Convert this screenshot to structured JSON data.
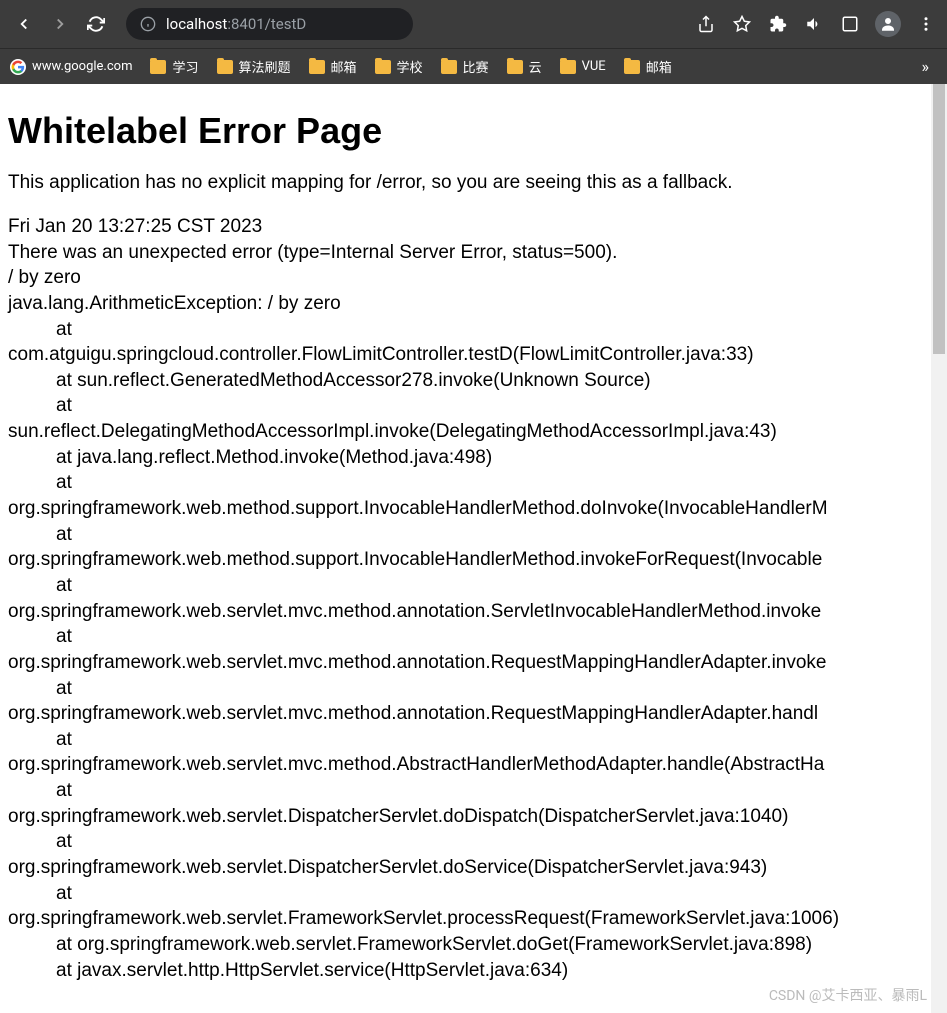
{
  "browser": {
    "url_host": "localhost",
    "url_port_path": ":8401/testD"
  },
  "bookmarks": [
    {
      "label": "www.google.com",
      "type": "google"
    },
    {
      "label": "学习",
      "type": "folder"
    },
    {
      "label": "算法刷题",
      "type": "folder"
    },
    {
      "label": "邮箱",
      "type": "folder"
    },
    {
      "label": "学校",
      "type": "folder"
    },
    {
      "label": "比赛",
      "type": "folder"
    },
    {
      "label": "云",
      "type": "folder"
    },
    {
      "label": "VUE",
      "type": "folder"
    },
    {
      "label": "邮箱",
      "type": "folder"
    }
  ],
  "more_bookmarks": "»",
  "page": {
    "title": "Whitelabel Error Page",
    "description": "This application has no explicit mapping for /error, so you are seeing this as a fallback.",
    "timestamp": "Fri Jan 20 13:27:25 CST 2023",
    "error_line": "There was an unexpected error (type=Internal Server Error, status=500).",
    "error_message": "/ by zero",
    "exception": "java.lang.ArithmeticException: / by zero",
    "stack_trace": [
      {
        "indent": true,
        "text": "at"
      },
      {
        "indent": false,
        "text": "com.atguigu.springcloud.controller.FlowLimitController.testD(FlowLimitController.java:33)"
      },
      {
        "indent": true,
        "text": "at sun.reflect.GeneratedMethodAccessor278.invoke(Unknown Source)"
      },
      {
        "indent": true,
        "text": "at"
      },
      {
        "indent": false,
        "text": "sun.reflect.DelegatingMethodAccessorImpl.invoke(DelegatingMethodAccessorImpl.java:43)"
      },
      {
        "indent": true,
        "text": "at java.lang.reflect.Method.invoke(Method.java:498)"
      },
      {
        "indent": true,
        "text": "at"
      },
      {
        "indent": false,
        "text": "org.springframework.web.method.support.InvocableHandlerMethod.doInvoke(InvocableHandlerM"
      },
      {
        "indent": true,
        "text": "at"
      },
      {
        "indent": false,
        "text": "org.springframework.web.method.support.InvocableHandlerMethod.invokeForRequest(Invocable"
      },
      {
        "indent": true,
        "text": "at"
      },
      {
        "indent": false,
        "text": "org.springframework.web.servlet.mvc.method.annotation.ServletInvocableHandlerMethod.invoke"
      },
      {
        "indent": true,
        "text": "at"
      },
      {
        "indent": false,
        "text": "org.springframework.web.servlet.mvc.method.annotation.RequestMappingHandlerAdapter.invoke"
      },
      {
        "indent": true,
        "text": "at"
      },
      {
        "indent": false,
        "text": "org.springframework.web.servlet.mvc.method.annotation.RequestMappingHandlerAdapter.handl"
      },
      {
        "indent": true,
        "text": "at"
      },
      {
        "indent": false,
        "text": "org.springframework.web.servlet.mvc.method.AbstractHandlerMethodAdapter.handle(AbstractHa"
      },
      {
        "indent": true,
        "text": "at"
      },
      {
        "indent": false,
        "text": "org.springframework.web.servlet.DispatcherServlet.doDispatch(DispatcherServlet.java:1040)"
      },
      {
        "indent": true,
        "text": "at"
      },
      {
        "indent": false,
        "text": "org.springframework.web.servlet.DispatcherServlet.doService(DispatcherServlet.java:943)"
      },
      {
        "indent": true,
        "text": "at"
      },
      {
        "indent": false,
        "text": "org.springframework.web.servlet.FrameworkServlet.processRequest(FrameworkServlet.java:1006)"
      },
      {
        "indent": true,
        "text": "at org.springframework.web.servlet.FrameworkServlet.doGet(FrameworkServlet.java:898)"
      },
      {
        "indent": true,
        "text": "at javax.servlet.http.HttpServlet.service(HttpServlet.java:634)"
      }
    ]
  },
  "watermark": "CSDN @艾卡西亚、暴雨L"
}
